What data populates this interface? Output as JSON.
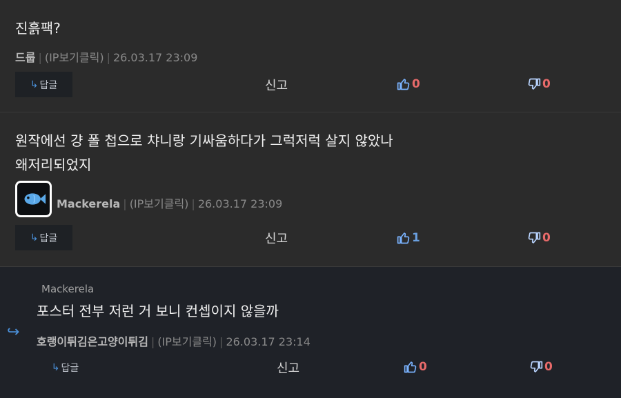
{
  "comments": [
    {
      "text": "진흙팩?",
      "nick": "드룹",
      "ip": "(IP보기클릭)",
      "date": "26.03.17 23:09",
      "reply_label": "답글",
      "report_label": "신고",
      "up": "0",
      "down": "0"
    },
    {
      "text_line1": "원작에선 걍 폴 첩으로 챠니랑 기싸움하다가 그럭저럭 살지 않았나",
      "text_line2": "왜저리되었지",
      "nick": "Mackerela",
      "ip": "(IP보기클릭)",
      "date": "26.03.17 23:09",
      "reply_label": "답글",
      "report_label": "신고",
      "up": "1",
      "down": "0"
    },
    {
      "parent_nick": "Mackerela",
      "text": "포스터 전부 저런 거 보니 컨셉이지 않을까",
      "nick": "호랭이튀김은고양이튀김",
      "ip": "(IP보기클릭)",
      "date": "26.03.17 23:14",
      "reply_label": "답글",
      "report_label": "신고",
      "up": "0",
      "down": "0"
    }
  ],
  "colors": {
    "accent_blue": "#4a90d9",
    "count_red": "#e86a6a",
    "reply_bg": "#1f2228"
  }
}
